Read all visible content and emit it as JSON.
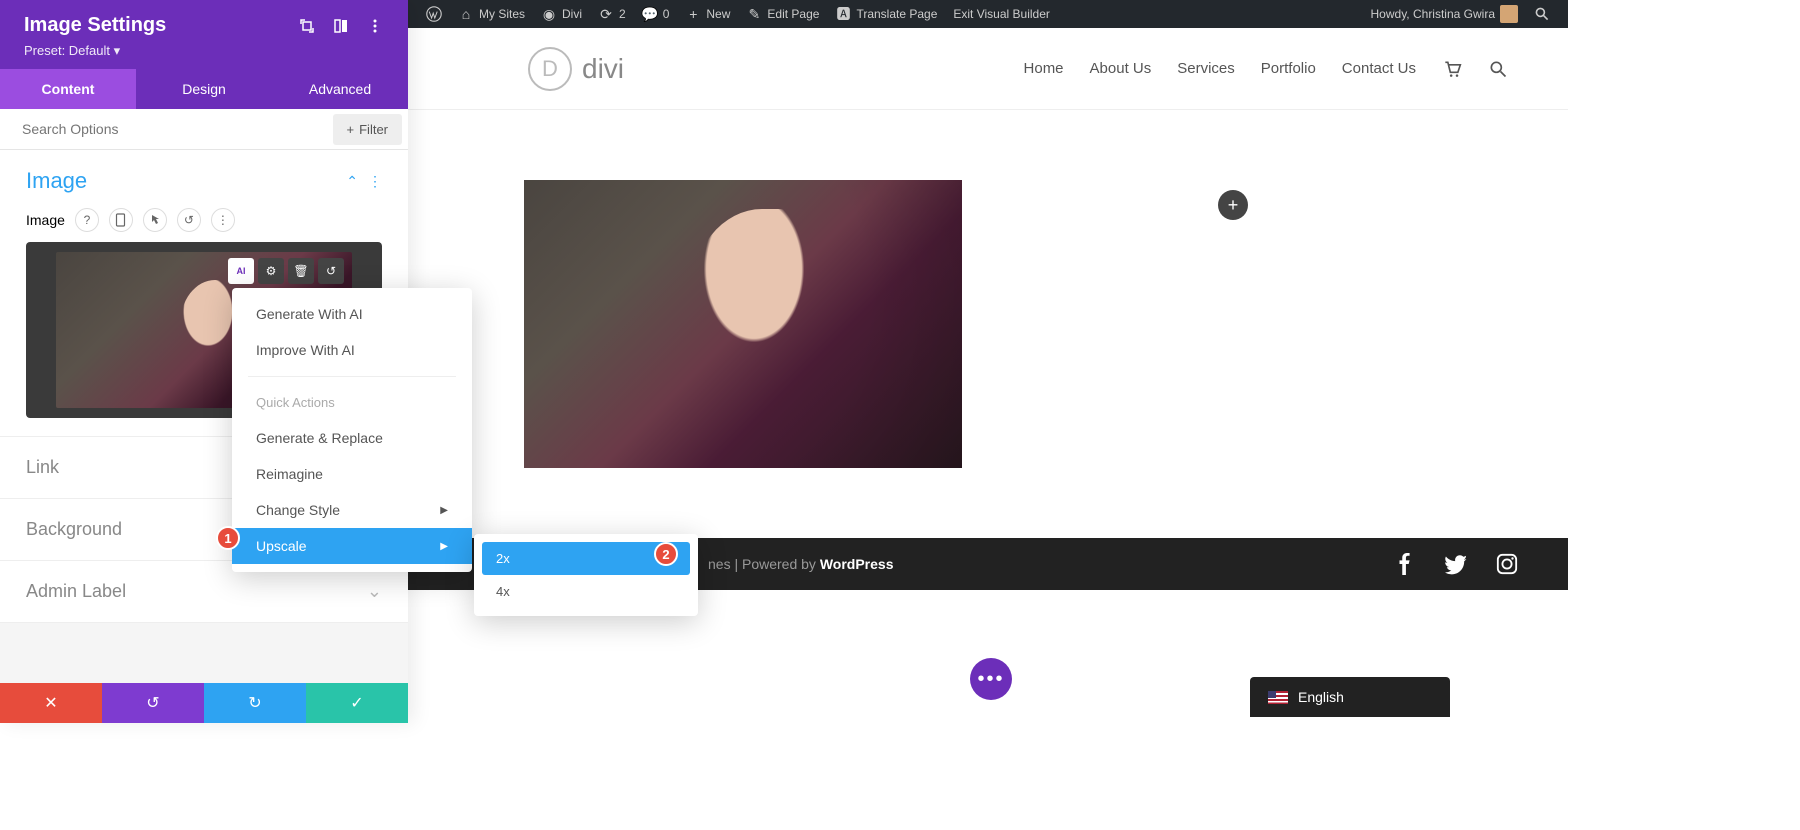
{
  "wp_bar": {
    "my_sites": "My Sites",
    "divi": "Divi",
    "updates": "2",
    "comments": "0",
    "new": "New",
    "edit_page": "Edit Page",
    "translate": "Translate Page",
    "exit_vb": "Exit Visual Builder",
    "howdy": "Howdy, Christina Gwira"
  },
  "header": {
    "logo_text": "divi",
    "nav": [
      "Home",
      "About Us",
      "Services",
      "Portfolio",
      "Contact Us"
    ]
  },
  "panel": {
    "title": "Image Settings",
    "preset": "Preset: Default",
    "tabs": [
      "Content",
      "Design",
      "Advanced"
    ],
    "search_placeholder": "Search Options",
    "filter": "Filter",
    "sections": {
      "image_title": "Image",
      "image_field_label": "Image",
      "link": "Link",
      "background": "Background",
      "admin_label": "Admin Label"
    }
  },
  "ai_badge": "AI",
  "menu1": {
    "gen_ai": "Generate With AI",
    "improve_ai": "Improve With AI",
    "quick_actions": "Quick Actions",
    "gen_replace": "Generate & Replace",
    "reimagine": "Reimagine",
    "change_style": "Change Style",
    "upscale": "Upscale"
  },
  "menu2": {
    "x2": "2x",
    "x4": "4x"
  },
  "badges": {
    "one": "1",
    "two": "2"
  },
  "footer": {
    "text_suffix": "nes",
    "sep": " | Powered by ",
    "wp": "WordPress"
  },
  "lang": "English"
}
